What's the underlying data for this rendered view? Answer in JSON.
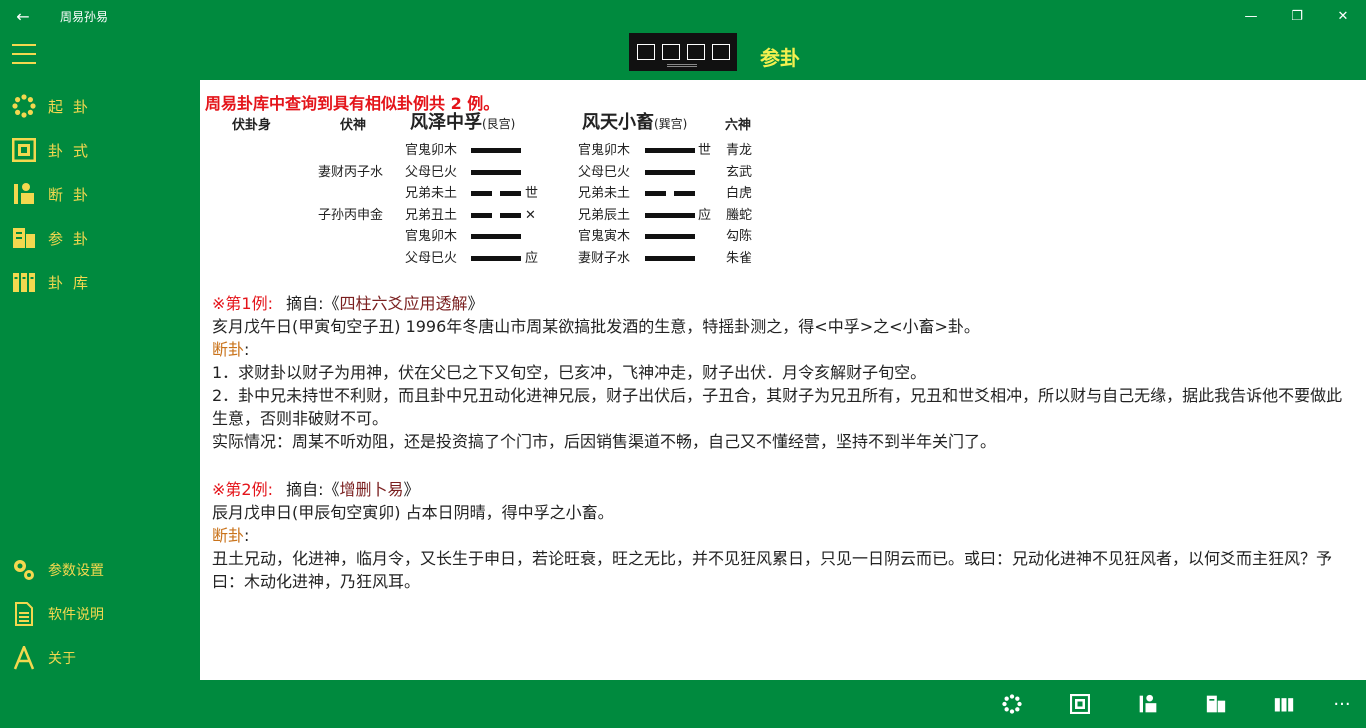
{
  "window": {
    "title": "周易孙易",
    "back": "←",
    "minimize": "—",
    "restore": "❐",
    "close": "✕"
  },
  "header": {
    "page_title": "参卦"
  },
  "sidebar": {
    "items": [
      {
        "label": "起卦",
        "icon": "circle-dots-icon"
      },
      {
        "label": "卦式",
        "icon": "hexagram-icon"
      },
      {
        "label": "断卦",
        "icon": "judge-icon"
      },
      {
        "label": "参卦",
        "icon": "reference-icon"
      },
      {
        "label": "卦库",
        "icon": "library-icon"
      }
    ],
    "bottom_items": [
      {
        "label": "参数设置",
        "icon": "settings-icon"
      },
      {
        "label": "软件说明",
        "icon": "document-icon"
      },
      {
        "label": "关于",
        "icon": "font-icon"
      }
    ]
  },
  "content": {
    "summary": "周易卦库中查询到具有相似卦例共 2 例。",
    "hexagram": {
      "col_fugua": "伏卦身",
      "col_fushen": "伏神",
      "main_name": "风泽中孚",
      "main_palace": "(艮宫)",
      "changed_name": "风天小畜",
      "changed_palace": "(巽宫)",
      "col_liushen": "六神",
      "rows": [
        {
          "fushen": "",
          "main": "官鬼卯木",
          "main_line": "yang",
          "main_mark": "",
          "changed": "官鬼卯木",
          "changed_line": "yang",
          "changed_mark": "世",
          "liushen": "青龙"
        },
        {
          "fushen": "妻财丙子水",
          "main": "父母巳火",
          "main_line": "yang",
          "main_mark": "",
          "changed": "父母巳火",
          "changed_line": "yang",
          "changed_mark": "",
          "liushen": "玄武"
        },
        {
          "fushen": "",
          "main": "兄弟未土",
          "main_line": "yin",
          "main_mark": "世",
          "changed": "兄弟未土",
          "changed_line": "yin",
          "changed_mark": "",
          "liushen": "白虎"
        },
        {
          "fushen": "子孙丙申金",
          "main": "兄弟丑土",
          "main_line": "yin",
          "main_mark": "✕",
          "changed": "兄弟辰土",
          "changed_line": "yang",
          "changed_mark": "应",
          "liushen": "螣蛇"
        },
        {
          "fushen": "",
          "main": "官鬼卯木",
          "main_line": "yang",
          "main_mark": "",
          "changed": "官鬼寅木",
          "changed_line": "yang",
          "changed_mark": "",
          "liushen": "勾陈"
        },
        {
          "fushen": "",
          "main": "父母巳火",
          "main_line": "yang",
          "main_mark": "应",
          "changed": "妻财子水",
          "changed_line": "yang",
          "changed_mark": "",
          "liushen": "朱雀"
        }
      ]
    },
    "case1": {
      "tag": "※第1例:",
      "source_prefix": "摘自:《",
      "source": "四柱六爻应用透解",
      "source_suffix": "》",
      "intro": "亥月戊午日(甲寅旬空子丑) 1996年冬唐山市周某欲搞批发酒的生意，特摇卦测之，得<中孚>之<小畜>卦。",
      "duan_label": "断卦",
      "duan_colon": ":",
      "p1": "1．求财卦以财子为用神，伏在父巳之下又旬空，巳亥冲，飞神冲走，财子出伏．月令亥解财子旬空。",
      "p2": "2．卦中兄未持世不利财，而且卦中兄丑动化进神兄辰，财子出伏后，子丑合，其财子为兄丑所有，兄丑和世爻相冲，所以财与自己无缘，据此我告诉他不要做此生意，否则非破财不可。",
      "p3": "实际情况：周某不听劝阻，还是投资搞了个门市，后因销售渠道不畅，自己又不懂经营，坚持不到半年关门了。"
    },
    "case2": {
      "tag": "※第2例:",
      "source_prefix": "摘自:《",
      "source": "增删卜易",
      "source_suffix": "》",
      "intro": "辰月戊申日(甲辰旬空寅卯) 占本日阴晴，得中孚之小畜。",
      "duan_label": "断卦",
      "duan_colon": ":",
      "p1": "丑土兄动，化进神，临月令，又长生于申日，若论旺衰，旺之无比，并不见狂风累日，只见一日阴云而已。或曰：兄动化进神不见狂风者，以何爻而主狂风？予曰：木动化进神，乃狂风耳。"
    }
  },
  "bottombar": {
    "more": "···"
  },
  "colors": {
    "brand_green": "#008a3e",
    "accent_yellow": "#f3d84f",
    "title_yellow": "#f3f04f",
    "alert_red": "#e4141a",
    "label_orange": "#c9731b"
  }
}
